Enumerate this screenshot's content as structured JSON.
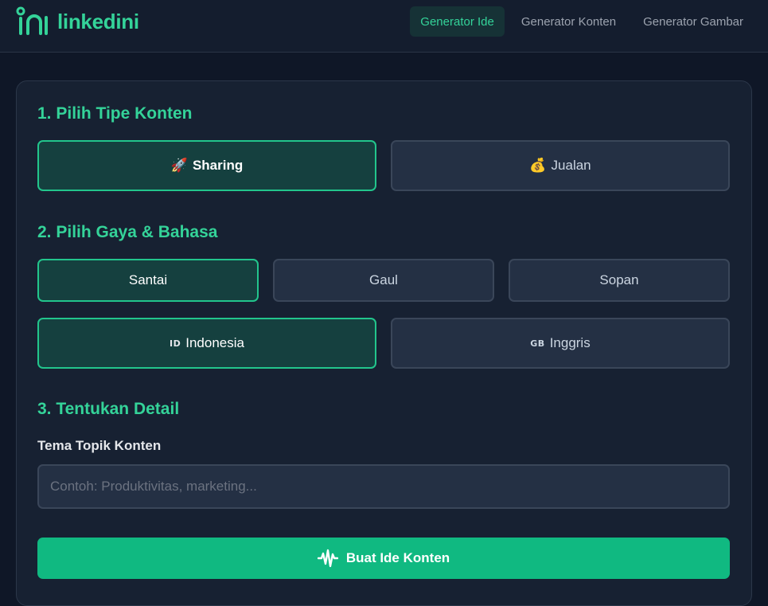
{
  "brand": {
    "name": "linkedini",
    "accent": "#34d399",
    "logo_icon": "in-logo-icon"
  },
  "nav": {
    "items": [
      {
        "label": "Generator Ide",
        "active": true
      },
      {
        "label": "Generator Konten",
        "active": false
      },
      {
        "label": "Generator Gambar",
        "active": false
      }
    ]
  },
  "section1": {
    "title": "1. Pilih Tipe Konten",
    "options": [
      {
        "icon": "🚀",
        "icon_name": "rocket-icon",
        "label": "Sharing",
        "selected": true
      },
      {
        "icon": "💰",
        "icon_name": "money-bag-icon",
        "label": "Jualan",
        "selected": false
      }
    ]
  },
  "section2": {
    "title": "2. Pilih Gaya & Bahasa",
    "styles": [
      {
        "label": "Santai",
        "selected": true
      },
      {
        "label": "Gaul",
        "selected": false
      },
      {
        "label": "Sopan",
        "selected": false
      }
    ],
    "languages": [
      {
        "flag": "ID",
        "icon_name": "flag-id-icon",
        "label": "Indonesia",
        "selected": true
      },
      {
        "flag": "GB",
        "icon_name": "flag-gb-icon",
        "label": "Inggris",
        "selected": false
      }
    ]
  },
  "section3": {
    "title": "3. Tentukan Detail",
    "topic_label": "Tema Topik Konten",
    "topic_value": "",
    "topic_placeholder": "Contoh: Produktivitas, marketing..."
  },
  "submit": {
    "label": "Buat Ide Konten",
    "icon_name": "waveform-icon",
    "color": "#10b981"
  }
}
